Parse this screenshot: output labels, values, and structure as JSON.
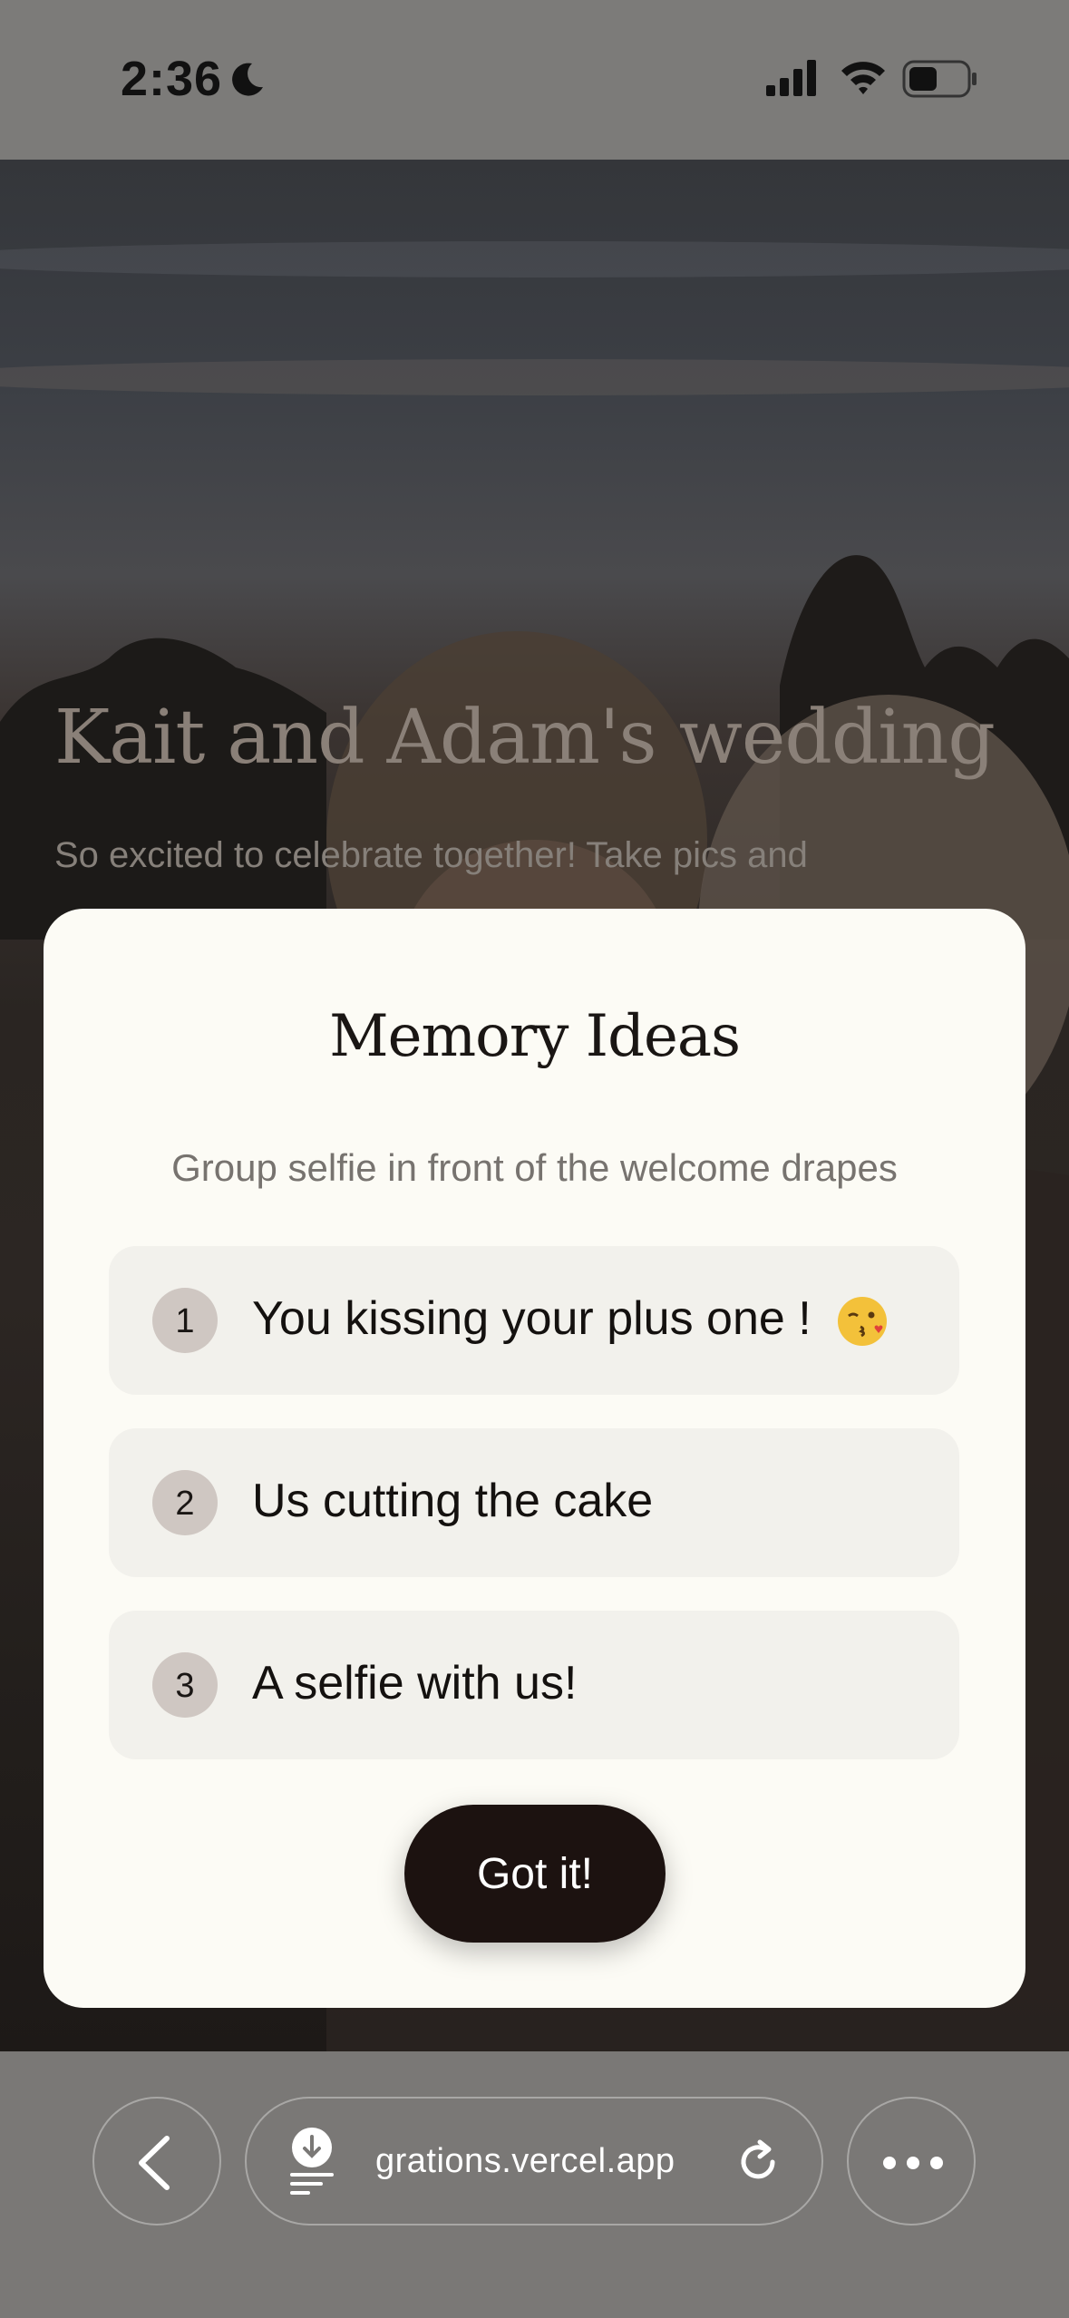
{
  "status_bar": {
    "time": "2:36",
    "icons": [
      "moon-icon",
      "signal-icon",
      "wifi-icon",
      "battery-icon"
    ]
  },
  "hero": {
    "title": "Kait and Adam's wedding",
    "subtitle": "So excited to celebrate together! Take pics and"
  },
  "modal": {
    "title": "Memory Ideas",
    "subtitle": "Group selfie in front of the welcome drapes",
    "ideas": [
      {
        "number": "1",
        "text": "You kissing your plus one !",
        "icon": "kissing-face-emoji-icon"
      },
      {
        "number": "2",
        "text": "Us cutting the cake"
      },
      {
        "number": "3",
        "text": "A selfie with us!"
      }
    ],
    "confirm_label": "Got it!"
  },
  "browser_bar": {
    "url": "grations.vercel.app",
    "icons": [
      "back-arrow-icon",
      "download-icon",
      "reload-icon",
      "more-icon"
    ]
  },
  "colors": {
    "modal_bg": "#fcfbf5",
    "idea_bg": "#f2f1ec",
    "number_badge": "#cfc7c2",
    "button_bg": "#1c1210",
    "overlay": "#7a7876"
  }
}
